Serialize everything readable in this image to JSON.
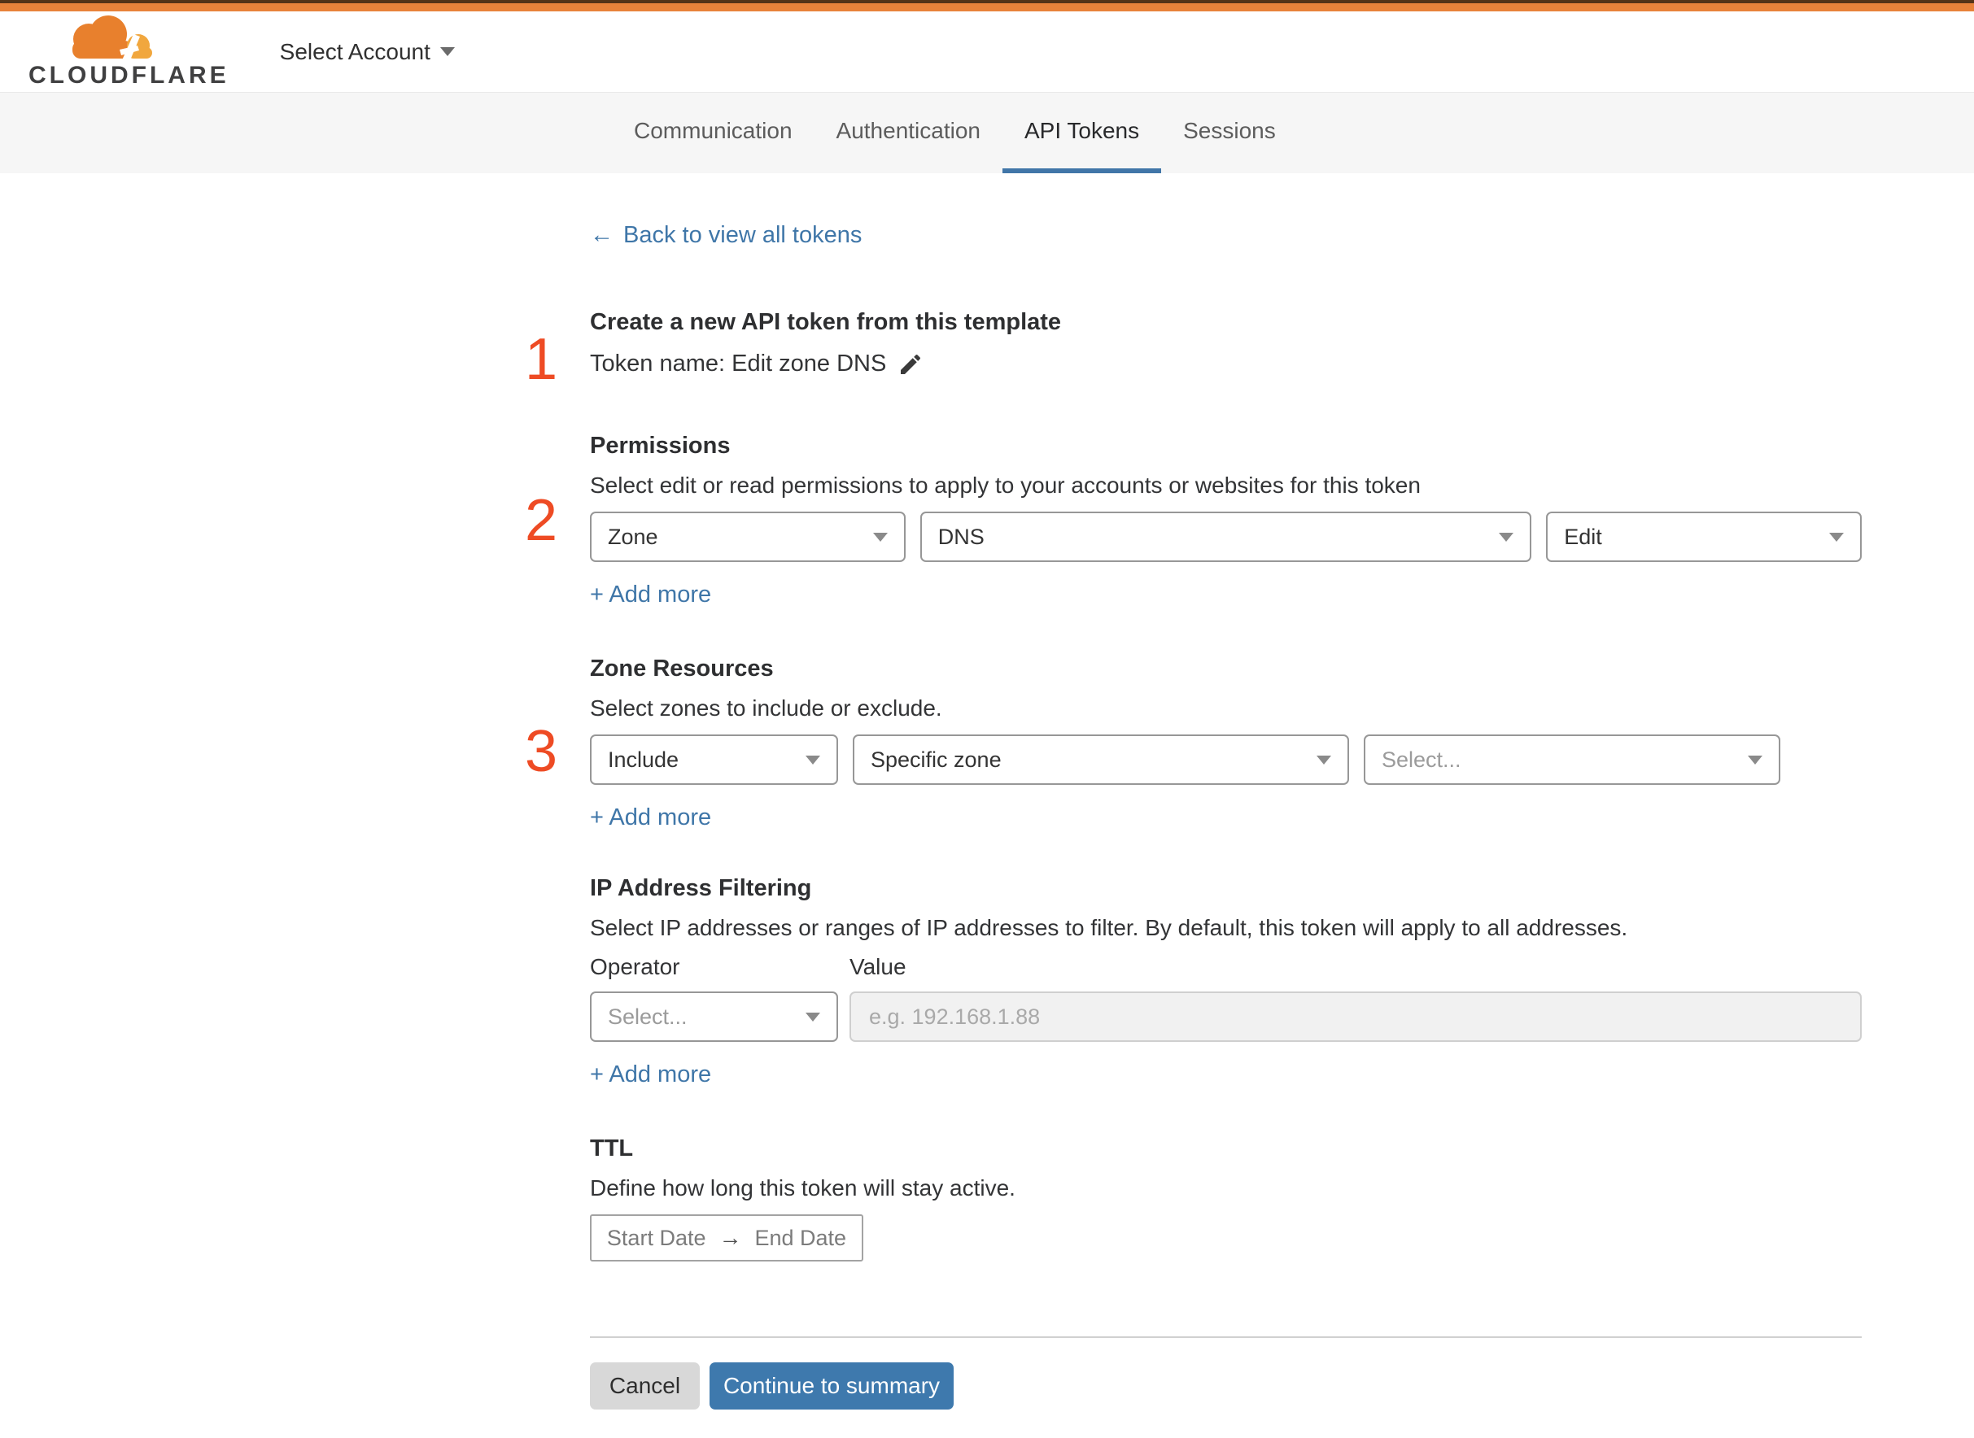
{
  "colors": {
    "accent_orange": "#e8823a",
    "link_blue": "#3f76a8",
    "button_blue": "#3e79ad",
    "step_red": "#ee4b24",
    "tab_underline": "#4176a8"
  },
  "header": {
    "logo_text": "CLOUDFLARE",
    "account_selector": "Select Account"
  },
  "tabs": {
    "items": [
      {
        "label": "Communication",
        "active": false
      },
      {
        "label": "Authentication",
        "active": false
      },
      {
        "label": "API Tokens",
        "active": true
      },
      {
        "label": "Sessions",
        "active": false
      }
    ]
  },
  "back_link": {
    "arrow": "←",
    "label": "Back to view all tokens"
  },
  "token": {
    "step": "1",
    "title": "Create a new API token from this template",
    "name_line": "Token name: Edit zone DNS"
  },
  "permissions": {
    "step": "2",
    "title": "Permissions",
    "description": "Select edit or read permissions to apply to your accounts or websites for this token",
    "scope_value": "Zone",
    "service_value": "DNS",
    "access_value": "Edit",
    "add_more": "+ Add more"
  },
  "zone_resources": {
    "step": "3",
    "title": "Zone Resources",
    "description": "Select zones to include or exclude.",
    "mode_value": "Include",
    "type_value": "Specific zone",
    "zone_placeholder": "Select...",
    "add_more": "+ Add more"
  },
  "ip_filtering": {
    "title": "IP Address Filtering",
    "description": "Select IP addresses or ranges of IP addresses to filter. By default, this token will apply to all addresses.",
    "operator_label": "Operator",
    "value_label": "Value",
    "operator_placeholder": "Select...",
    "value_placeholder": "e.g. 192.168.1.88",
    "add_more": "+ Add more"
  },
  "ttl": {
    "title": "TTL",
    "description": "Define how long this token will stay active.",
    "start_placeholder": "Start Date",
    "arrow": "→",
    "end_placeholder": "End Date"
  },
  "footer": {
    "cancel": "Cancel",
    "continue": "Continue to summary"
  }
}
